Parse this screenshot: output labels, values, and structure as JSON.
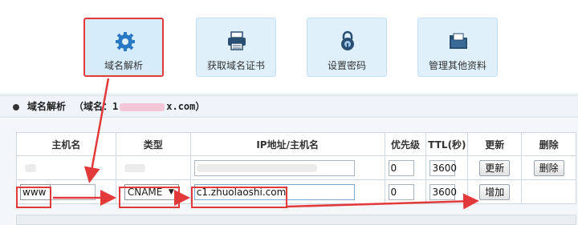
{
  "toolbar": {
    "tiles": [
      {
        "label": "域名解析",
        "icon": "gear-icon",
        "selected": true
      },
      {
        "label": "获取域名证书",
        "icon": "printer-icon",
        "selected": false
      },
      {
        "label": "设置密码",
        "icon": "lock-icon",
        "selected": false
      },
      {
        "label": "管理其他资料",
        "icon": "folder-icon",
        "selected": false
      }
    ]
  },
  "section": {
    "title": "域名解析",
    "domain_prefix": "（域名：",
    "domain_start": "1",
    "domain_end": "x.com）"
  },
  "table": {
    "headers": [
      "主机名",
      "类型",
      "IP地址/主机名",
      "优先级",
      "TTL(秒)",
      "更新",
      "删除"
    ],
    "existing_row": {
      "priority": "0",
      "ttl": "3600",
      "update_label": "更新",
      "delete_label": "删除"
    },
    "new_row": {
      "host": "www",
      "type": "CNAME",
      "value": "c1.zhuolaoshi.com",
      "priority": "0",
      "ttl": "3600",
      "add_label": "增加"
    }
  },
  "colors": {
    "annotation_red": "#e23a3a",
    "tile_bg": "#dff0fb",
    "header_bg": "#eef4fa"
  }
}
